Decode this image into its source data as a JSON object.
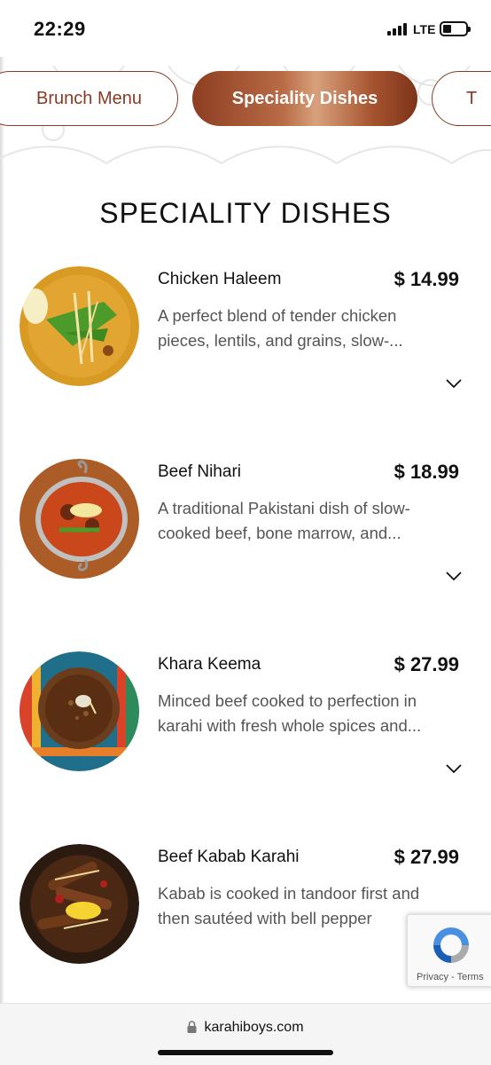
{
  "status": {
    "time": "22:29",
    "network": "LTE"
  },
  "tabs": [
    {
      "label": "Brunch Menu",
      "active": false
    },
    {
      "label": "Speciality Dishes",
      "active": true
    },
    {
      "label": "T",
      "active": false
    }
  ],
  "section_title": "SPECIALITY DISHES",
  "items": [
    {
      "name": "Chicken Haleem",
      "price": "$ 14.99",
      "desc_line1": "A perfect blend of tender chicken",
      "desc_line2": "pieces, lentils, and grains, slow-...",
      "image_icon": "chicken-haleem-photo"
    },
    {
      "name": "Beef Nihari",
      "price": "$ 18.99",
      "desc_line1": "A traditional Pakistani dish of slow-",
      "desc_line2": "cooked beef, bone marrow, and...",
      "image_icon": "beef-nihari-photo"
    },
    {
      "name": "Khara Keema",
      "price": "$ 27.99",
      "desc_line1": "Minced beef cooked to perfection in",
      "desc_line2": "karahi with fresh whole spices and...",
      "image_icon": "khara-keema-photo"
    },
    {
      "name": "Beef Kabab Karahi",
      "price": "$ 27.99",
      "desc_line1": "Kabab is cooked in tandoor first and",
      "desc_line2": "then sautéed with bell pepper",
      "image_icon": "beef-kabab-karahi-photo"
    }
  ],
  "recaptcha": {
    "links": "Privacy - Terms"
  },
  "browser": {
    "url": "karahiboys.com"
  },
  "colors": {
    "accent": "#8a3a24",
    "copper": "#b86b45",
    "text": "#111111",
    "muted": "#555555"
  }
}
